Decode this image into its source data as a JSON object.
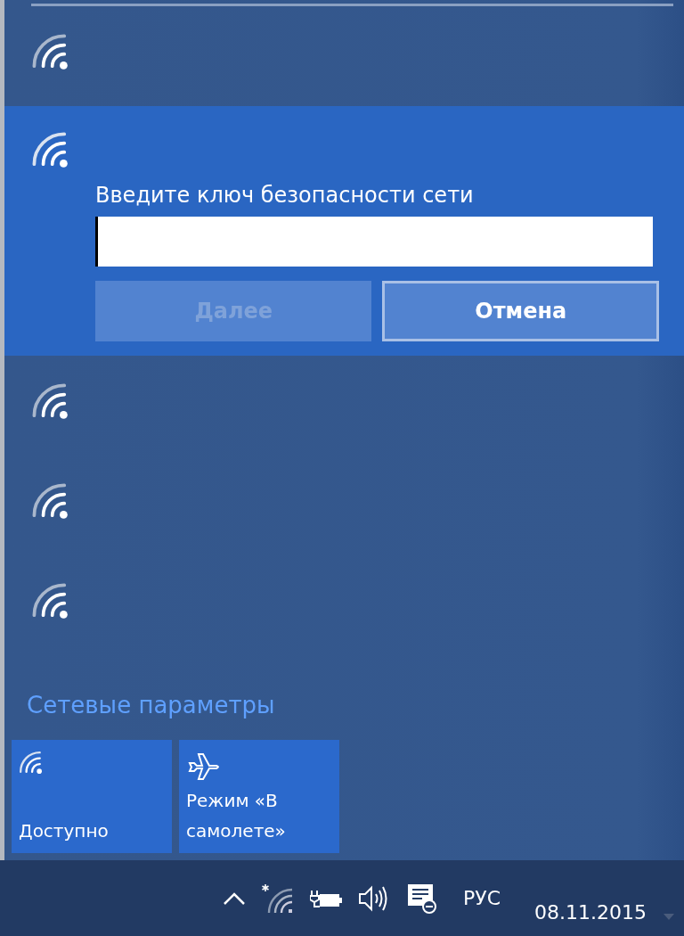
{
  "networks": [
    {
      "selected": false
    },
    {
      "selected": true,
      "prompt": "Введите ключ безопасности сети",
      "field": {
        "focused": true
      },
      "buttons": [
        {
          "label": "Далее",
          "disabled": true
        },
        {
          "label": "Отмена",
          "disabled": false
        }
      ]
    },
    {
      "selected": false
    },
    {
      "selected": false
    },
    {
      "selected": false
    }
  ],
  "settings_link": "Сетевые параметры",
  "tiles": [
    {
      "kind": "wifi",
      "label": "Доступно",
      "on": true
    },
    {
      "kind": "airplane",
      "label": "Режим «В самолете»",
      "on": true
    }
  ],
  "taskbar": {
    "language": "РУС",
    "date": "08.11.2015"
  }
}
